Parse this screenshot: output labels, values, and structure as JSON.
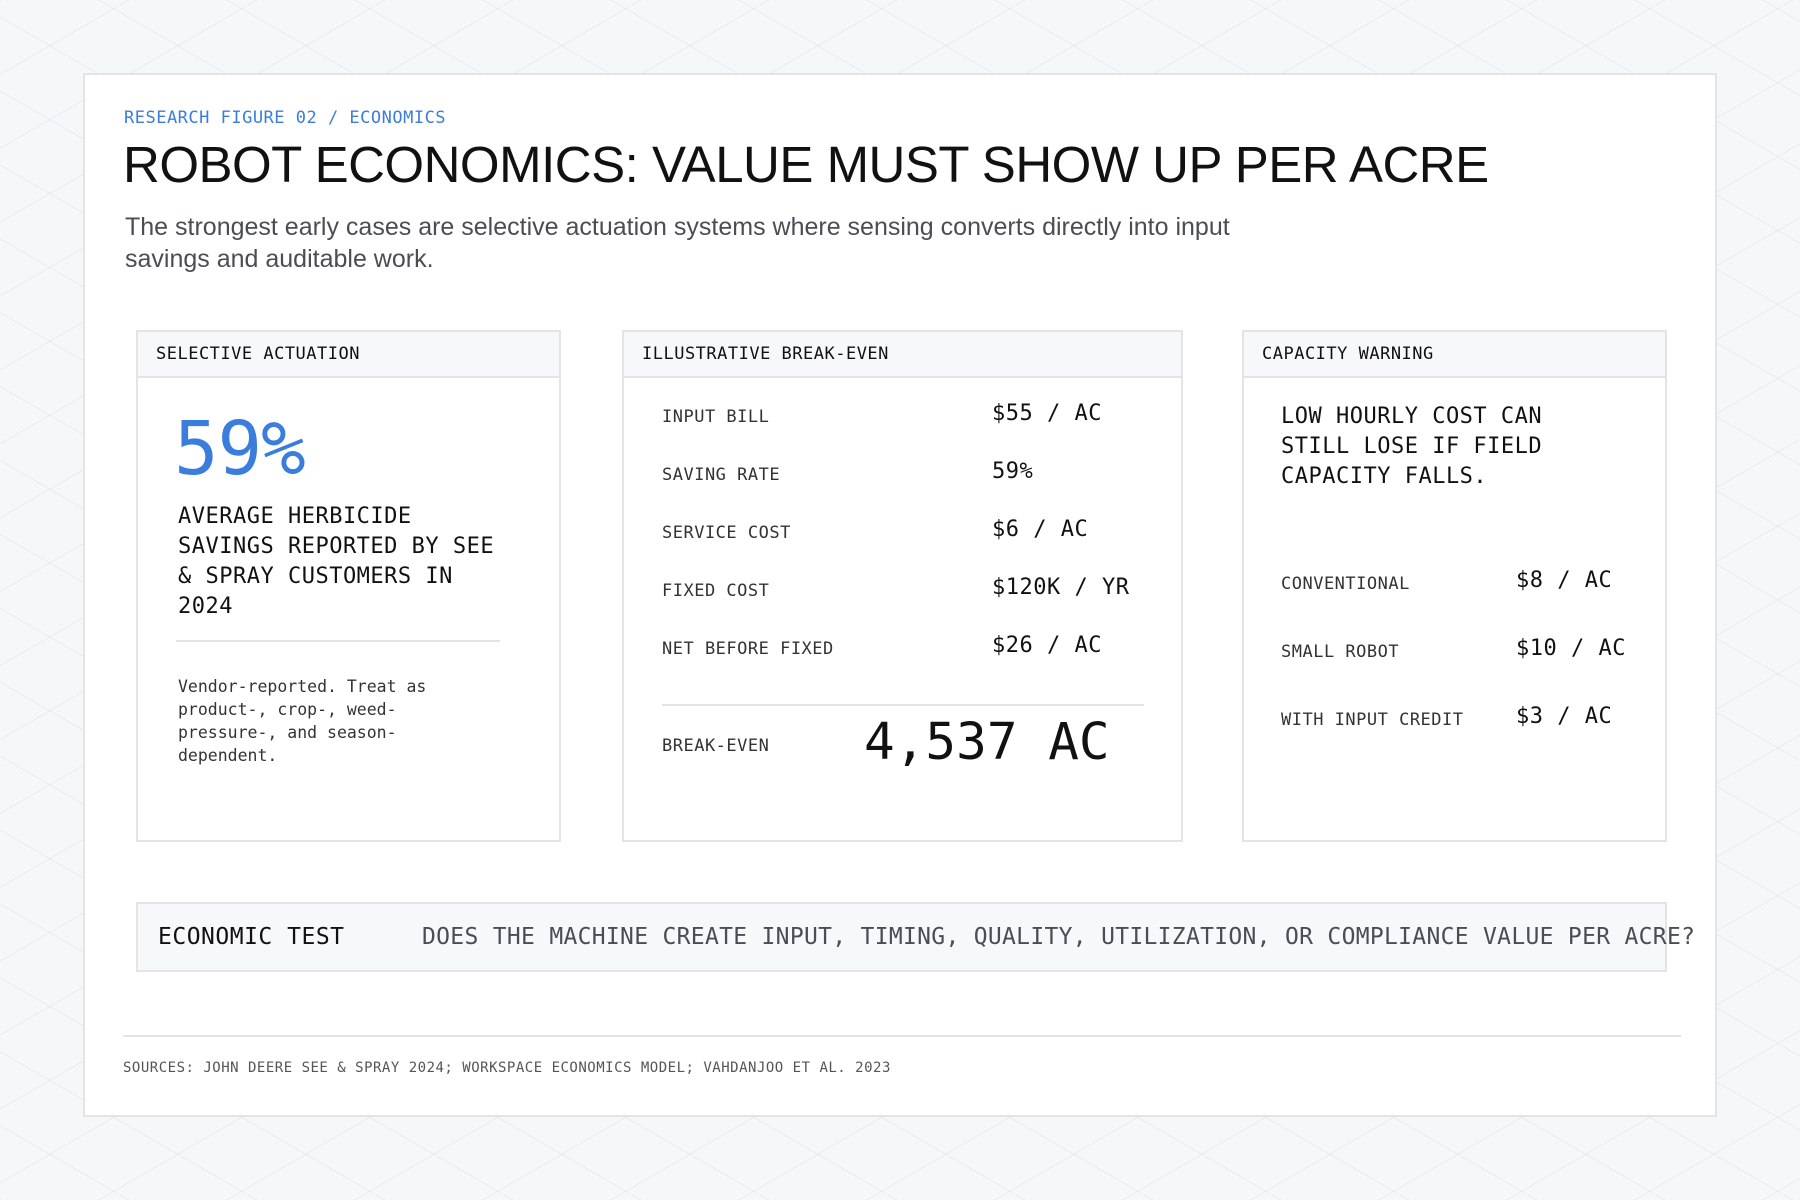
{
  "header": {
    "eyebrow": "RESEARCH FIGURE 02 / ECONOMICS",
    "title": "ROBOT ECONOMICS: VALUE MUST SHOW UP PER ACRE",
    "subtitle": "The strongest early cases are selective actuation systems where sensing converts directly into input savings and auditable work."
  },
  "selective_actuation": {
    "heading": "SELECTIVE ACTUATION",
    "stat": "59%",
    "description": "AVERAGE HERBICIDE SAVINGS REPORTED BY SEE & SPRAY CUSTOMERS IN 2024",
    "note": "Vendor-reported. Treat as product-, crop-, weed-pressure-, and season-dependent."
  },
  "break_even": {
    "heading": "ILLUSTRATIVE BREAK-EVEN",
    "rows": [
      {
        "label": "INPUT BILL",
        "value": "$55 / AC"
      },
      {
        "label": "SAVING RATE",
        "value": "59%"
      },
      {
        "label": "SERVICE COST",
        "value": "$6 / AC"
      },
      {
        "label": "FIXED COST",
        "value": "$120K / YR"
      },
      {
        "label": "NET BEFORE FIXED",
        "value": "$26 / AC"
      }
    ],
    "result_label": "BREAK-EVEN",
    "result_value": "4,537 AC"
  },
  "capacity_warning": {
    "heading": "CAPACITY WARNING",
    "text": "LOW HOURLY COST CAN STILL LOSE IF FIELD CAPACITY FALLS.",
    "rows": [
      {
        "label": "CONVENTIONAL",
        "value": "$8 / AC"
      },
      {
        "label": "SMALL ROBOT",
        "value": "$10 / AC"
      },
      {
        "label": "WITH INPUT CREDIT",
        "value": "$3 / AC"
      }
    ]
  },
  "economic_test": {
    "label": "ECONOMIC TEST",
    "question": "DOES THE MACHINE CREATE INPUT, TIMING, QUALITY, UTILIZATION, OR COMPLIANCE VALUE PER ACRE?"
  },
  "footer": {
    "sources": "SOURCES: JOHN DEERE SEE & SPRAY 2024; WORKSPACE ECONOMICS MODEL; VAHDANJOO ET AL. 2023"
  },
  "colors": {
    "accent": "#3b7ddd",
    "border": "#e2e4e8",
    "panel": "#f7f8fa"
  }
}
